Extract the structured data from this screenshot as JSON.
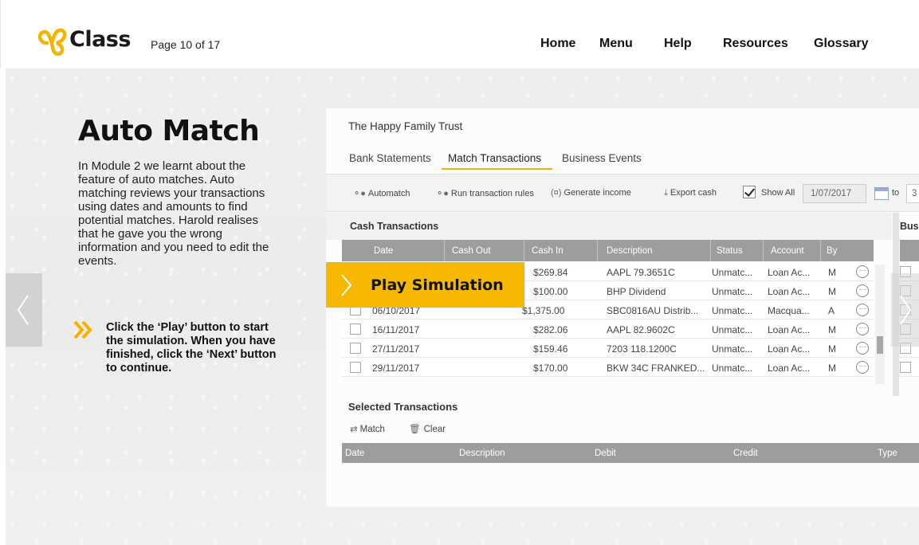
{
  "header": {
    "logo_text": "Class",
    "page_count": "Page 10 of 17",
    "nav": [
      "Home",
      "Menu",
      "Help",
      "Resources",
      "Glossary"
    ]
  },
  "lesson": {
    "title": "Auto Match",
    "body": "In Module 2 we learnt about the feature of auto matches. Auto matching reviews your transactions using dates and amounts to find potential matches. Harold realises that he gave you the wrong information and you need to edit the events.",
    "instruction": "Click the ‘Play’ button to start the simulation. When you have finished, click the ‘Next’ button to continue."
  },
  "play_button": {
    "label": "Play Simulation"
  },
  "app": {
    "title": "The Happy Family Trust",
    "tabs": [
      "Bank Statements",
      "Match Transactions",
      "Business Events"
    ],
    "active_tab": "Match Transactions",
    "toolbar": {
      "automatch": "Automatch",
      "run_rules": "Run transaction rules",
      "generate_income": "Generate income",
      "export_cash": "Export cash",
      "show_all": "Show All",
      "date_from": "1/07/2017",
      "to_label": "to",
      "date_to": "3"
    },
    "cash_title": "Cash Transactions",
    "bus_title": "Bus",
    "columns": [
      "Date",
      "Cash Out",
      "Cash In",
      "Description",
      "Status",
      "Account",
      "By"
    ],
    "rows": [
      {
        "date": "",
        "cash_out": "",
        "cash_in": "$269.84",
        "description": "AAPL 79.3651C",
        "status": "Unmatc...",
        "account": "Loan Ac...",
        "by": "M"
      },
      {
        "date": "",
        "cash_out": "",
        "cash_in": "$100.00",
        "description": "BHP Dividend",
        "status": "Unmatc...",
        "account": "Loan Ac...",
        "by": "M"
      },
      {
        "date": "06/10/2017",
        "cash_out": "",
        "cash_in": "$1,375.00",
        "description": "SBC0816AU Distrib...",
        "status": "Unmatc...",
        "account": "Macqua...",
        "by": "A"
      },
      {
        "date": "16/11/2017",
        "cash_out": "",
        "cash_in": "$282.06",
        "description": "AAPL 82.9602C",
        "status": "Unmatc...",
        "account": "Loan Ac...",
        "by": "M"
      },
      {
        "date": "27/11/2017",
        "cash_out": "",
        "cash_in": "$159.46",
        "description": "7203 118.1200C",
        "status": "Unmatc...",
        "account": "Loan Ac...",
        "by": "M"
      },
      {
        "date": "29/11/2017",
        "cash_out": "",
        "cash_in": "$170.00",
        "description": "BKW 34C FRANKED...",
        "status": "Unmatc...",
        "account": "Loan Ac...",
        "by": "M"
      }
    ],
    "selected_title": "Selected Transactions",
    "selected_tools": [
      "Match",
      "Clear"
    ],
    "selected_columns": [
      "Date",
      "Description",
      "Debit",
      "Credit",
      "Type"
    ]
  }
}
